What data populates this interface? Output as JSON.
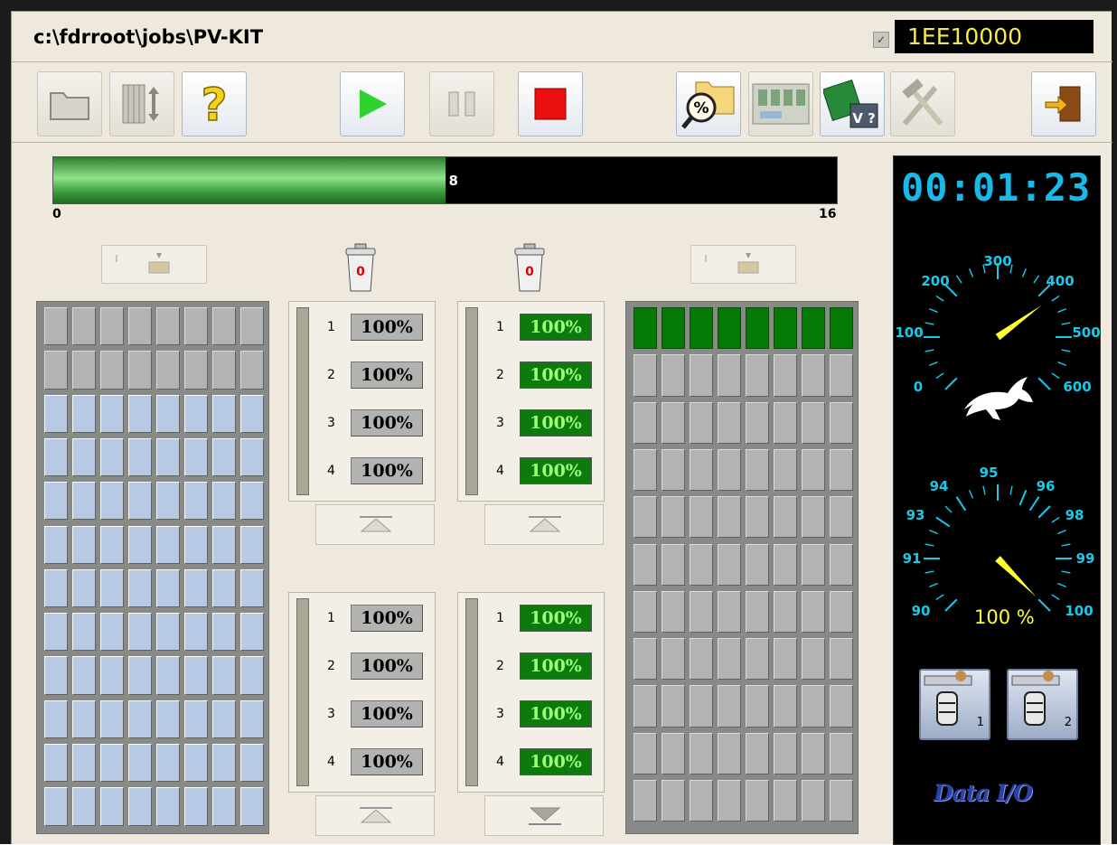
{
  "window": {
    "job_path": "c:\\fdrroot\\jobs\\PV-KIT",
    "device_code": "1EE10000",
    "checksum_icon": "checksum-icon"
  },
  "toolbar": {
    "buttons": [
      {
        "name": "open-job-button",
        "icon": "folder-icon",
        "enabled": false
      },
      {
        "name": "tray-map-button",
        "icon": "tray-sort-icon",
        "enabled": false
      },
      {
        "name": "help-button",
        "icon": "question-mark-icon",
        "enabled": true
      },
      {
        "name": "run-button",
        "icon": "play-icon",
        "enabled": true
      },
      {
        "name": "pause-button",
        "icon": "pause-icon",
        "enabled": false
      },
      {
        "name": "stop-button",
        "icon": "stop-icon",
        "enabled": true
      },
      {
        "name": "statistics-button",
        "icon": "percent-folder-icon",
        "enabled": true
      },
      {
        "name": "socket-map-button",
        "icon": "socket-board-icon",
        "enabled": false
      },
      {
        "name": "verify-button",
        "icon": "verify-board-icon",
        "enabled": true
      },
      {
        "name": "tools-button",
        "icon": "hammer-icon",
        "enabled": false
      },
      {
        "name": "exit-button",
        "icon": "exit-door-icon",
        "enabled": true
      }
    ]
  },
  "progress": {
    "current": "8",
    "min": "0",
    "max": "16",
    "fraction": 0.5
  },
  "reject_bins": [
    {
      "count": "0"
    },
    {
      "count": "0"
    }
  ],
  "input_tray": {
    "rows": 12,
    "cols": 8,
    "row_states": [
      "gray",
      "gray",
      "blue",
      "blue",
      "blue",
      "blue",
      "blue",
      "blue",
      "blue",
      "blue",
      "blue",
      "blue"
    ]
  },
  "output_tray": {
    "rows": 11,
    "cols": 8,
    "row_states": [
      "green",
      "gray",
      "gray",
      "gray",
      "gray",
      "gray",
      "gray",
      "gray",
      "gray",
      "gray",
      "gray"
    ]
  },
  "sites": [
    {
      "state": "gray",
      "sockets": [
        {
          "index": "1",
          "value": "100%"
        },
        {
          "index": "2",
          "value": "100%"
        },
        {
          "index": "3",
          "value": "100%"
        },
        {
          "index": "4",
          "value": "100%"
        }
      ]
    },
    {
      "state": "green",
      "sockets": [
        {
          "index": "1",
          "value": "100%"
        },
        {
          "index": "2",
          "value": "100%"
        },
        {
          "index": "3",
          "value": "100%"
        },
        {
          "index": "4",
          "value": "100%"
        }
      ]
    },
    {
      "state": "gray",
      "sockets": [
        {
          "index": "1",
          "value": "100%"
        },
        {
          "index": "2",
          "value": "100%"
        },
        {
          "index": "3",
          "value": "100%"
        },
        {
          "index": "4",
          "value": "100%"
        }
      ]
    },
    {
      "state": "green",
      "sockets": [
        {
          "index": "1",
          "value": "100%"
        },
        {
          "index": "2",
          "value": "100%"
        },
        {
          "index": "3",
          "value": "100%"
        },
        {
          "index": "4",
          "value": "100%"
        }
      ]
    }
  ],
  "status": {
    "elapsed": "00:01:23",
    "throughput_labels": [
      "0",
      "100",
      "200",
      "300",
      "400",
      "500",
      "600"
    ],
    "throughput_value": 420,
    "yield_labels": [
      "90",
      "91",
      "93",
      "94",
      "95",
      "96",
      "98",
      "99",
      "100"
    ],
    "yield_value": 100,
    "yield_text": "100 %",
    "socket_buttons": [
      {
        "label": "1"
      },
      {
        "label": "2"
      }
    ],
    "logo": "Data I/O"
  },
  "colors": {
    "panel_bg": "#efe9dd",
    "progress_green": "#3a9b3c",
    "gauge_cyan": "#19c9e9",
    "needle_yellow": "#ffff33",
    "pass_green": "#047a04",
    "device_blue": "#b7c9e3"
  }
}
